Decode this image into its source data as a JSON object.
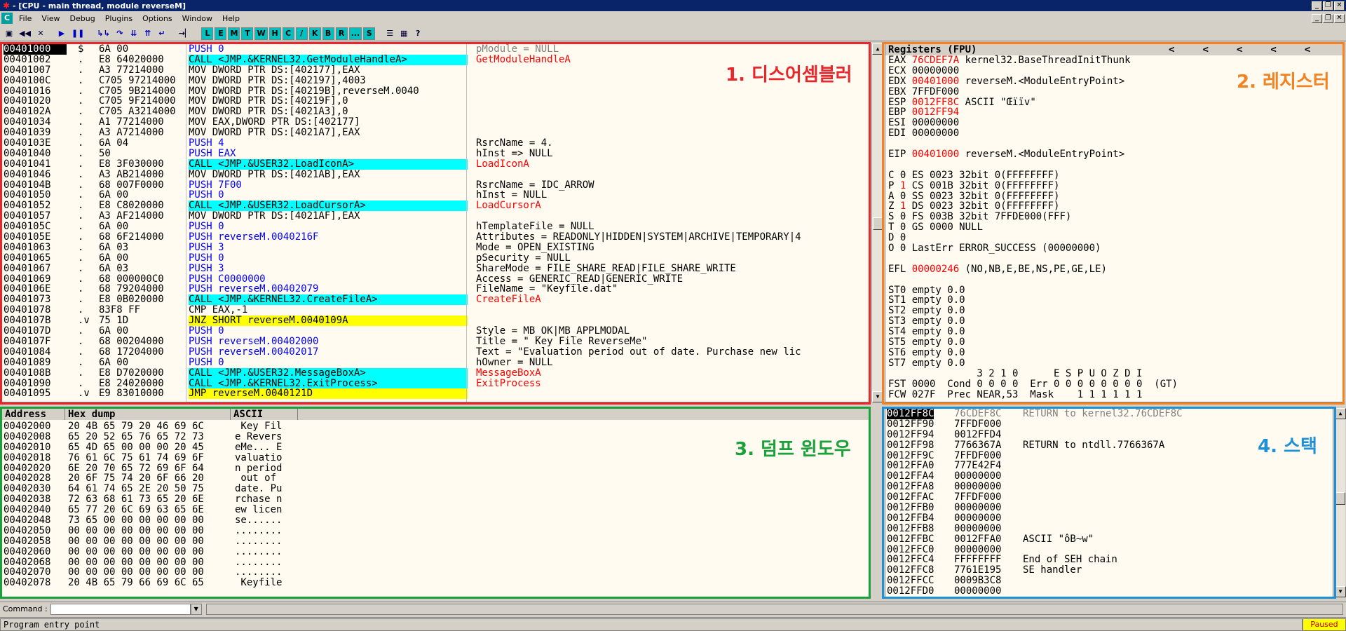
{
  "window": {
    "title": "- [CPU - main thread, module reverseM]"
  },
  "menu": [
    "File",
    "View",
    "Debug",
    "Plugins",
    "Options",
    "Window",
    "Help"
  ],
  "toolbar_letters": [
    "L",
    "E",
    "M",
    "T",
    "W",
    "H",
    "C",
    "/",
    "K",
    "B",
    "R",
    "...",
    "S"
  ],
  "disasm": [
    [
      "00401000",
      "$",
      "6A 00",
      "PUSH 0",
      "pModule = NULL"
    ],
    [
      "00401002",
      ".",
      "E8 64020000",
      "CALL <JMP.&KERNEL32.GetModuleHandleA>",
      "GetModuleHandleA"
    ],
    [
      "00401007",
      ".",
      "A3 77214000",
      "MOV DWORD PTR DS:[402177],EAX",
      ""
    ],
    [
      "0040100C",
      ".",
      "C705 97214000",
      "MOV DWORD PTR DS:[402197],4003",
      ""
    ],
    [
      "00401016",
      ".",
      "C705 9B214000",
      "MOV DWORD PTR DS:[40219B],reverseM.0040",
      ""
    ],
    [
      "00401020",
      ".",
      "C705 9F214000",
      "MOV DWORD PTR DS:[40219F],0",
      ""
    ],
    [
      "0040102A",
      ".",
      "C705 A3214000",
      "MOV DWORD PTR DS:[4021A3],0",
      ""
    ],
    [
      "00401034",
      ".",
      "A1 77214000",
      "MOV EAX,DWORD PTR DS:[402177]",
      ""
    ],
    [
      "00401039",
      ".",
      "A3 A7214000",
      "MOV DWORD PTR DS:[4021A7],EAX",
      ""
    ],
    [
      "0040103E",
      ".",
      "6A 04",
      "PUSH 4",
      "RsrcName = 4."
    ],
    [
      "00401040",
      ".",
      "50",
      "PUSH EAX",
      "hInst => NULL"
    ],
    [
      "00401041",
      ".",
      "E8 3F030000",
      "CALL <JMP.&USER32.LoadIconA>",
      "LoadIconA"
    ],
    [
      "00401046",
      ".",
      "A3 AB214000",
      "MOV DWORD PTR DS:[4021AB],EAX",
      ""
    ],
    [
      "0040104B",
      ".",
      "68 007F0000",
      "PUSH 7F00",
      "RsrcName = IDC_ARROW"
    ],
    [
      "00401050",
      ".",
      "6A 00",
      "PUSH 0",
      "hInst = NULL"
    ],
    [
      "00401052",
      ".",
      "E8 C8020000",
      "CALL <JMP.&USER32.LoadCursorA>",
      "LoadCursorA"
    ],
    [
      "00401057",
      ".",
      "A3 AF214000",
      "MOV DWORD PTR DS:[4021AF],EAX",
      ""
    ],
    [
      "0040105C",
      ".",
      "6A 00",
      "PUSH 0",
      "hTemplateFile = NULL"
    ],
    [
      "0040105E",
      ".",
      "68 6F214000",
      "PUSH reverseM.0040216F",
      "Attributes = READONLY|HIDDEN|SYSTEM|ARCHIVE|TEMPORARY|4"
    ],
    [
      "00401063",
      ".",
      "6A 03",
      "PUSH 3",
      "Mode = OPEN_EXISTING"
    ],
    [
      "00401065",
      ".",
      "6A 00",
      "PUSH 0",
      "pSecurity = NULL"
    ],
    [
      "00401067",
      ".",
      "6A 03",
      "PUSH 3",
      "ShareMode = FILE_SHARE_READ|FILE_SHARE_WRITE"
    ],
    [
      "00401069",
      ".",
      "68 000000C0",
      "PUSH C0000000",
      "Access = GENERIC_READ|GENERIC_WRITE"
    ],
    [
      "0040106E",
      ".",
      "68 79204000",
      "PUSH reverseM.00402079",
      "FileName = \"Keyfile.dat\""
    ],
    [
      "00401073",
      ".",
      "E8 0B020000",
      "CALL <JMP.&KERNEL32.CreateFileA>",
      "CreateFileA"
    ],
    [
      "00401078",
      ".",
      "83F8 FF",
      "CMP EAX,-1",
      ""
    ],
    [
      "0040107B",
      ".v",
      "75 1D",
      "JNZ SHORT reverseM.0040109A",
      ""
    ],
    [
      "0040107D",
      ".",
      "6A 00",
      "PUSH 0",
      "Style = MB_OK|MB_APPLMODAL"
    ],
    [
      "0040107F",
      ".",
      "68 00204000",
      "PUSH reverseM.00402000",
      "Title = \" Key File ReverseMe\""
    ],
    [
      "00401084",
      ".",
      "68 17204000",
      "PUSH reverseM.00402017",
      "Text = \"Evaluation period out of date. Purchase new lic"
    ],
    [
      "00401089",
      ".",
      "6A 00",
      "PUSH 0",
      "hOwner = NULL"
    ],
    [
      "0040108B",
      ".",
      "E8 D7020000",
      "CALL <JMP.&USER32.MessageBoxA>",
      "MessageBoxA"
    ],
    [
      "00401090",
      ".",
      "E8 24020000",
      "CALL <JMP.&KERNEL32.ExitProcess>",
      "ExitProcess"
    ],
    [
      "00401095",
      ".v",
      "E9 83010000",
      "JMP reverseM.0040121D",
      ""
    ]
  ],
  "registers": {
    "header": "Registers (FPU)",
    "header_arrows": [
      "<",
      "<",
      "<",
      "<",
      "<"
    ],
    "gp": [
      [
        "EAX",
        "76CDEF7A",
        "kernel32.BaseThreadInitThunk"
      ],
      [
        "ECX",
        "00000000",
        ""
      ],
      [
        "EDX",
        "00401000",
        "reverseM.<ModuleEntryPoint>"
      ],
      [
        "EBX",
        "7FFDF000",
        ""
      ],
      [
        "ESP",
        "0012FF8C",
        "ASCII \"Œïïv\""
      ],
      [
        "EBP",
        "0012FF94",
        ""
      ],
      [
        "ESI",
        "00000000",
        ""
      ],
      [
        "EDI",
        "00000000",
        ""
      ]
    ],
    "eip": [
      "EIP",
      "00401000",
      "reverseM.<ModuleEntryPoint>"
    ],
    "flags": [
      [
        "C",
        "0",
        "ES 0023 32bit 0(FFFFFFFF)"
      ],
      [
        "P",
        "1",
        "CS 001B 32bit 0(FFFFFFFF)"
      ],
      [
        "A",
        "0",
        "SS 0023 32bit 0(FFFFFFFF)"
      ],
      [
        "Z",
        "1",
        "DS 0023 32bit 0(FFFFFFFF)"
      ],
      [
        "S",
        "0",
        "FS 003B 32bit 7FFDE000(FFF)"
      ],
      [
        "T",
        "0",
        "GS 0000 NULL"
      ],
      [
        "D",
        "0",
        ""
      ],
      [
        "O",
        "0",
        "LastErr ERROR_SUCCESS (00000000)"
      ]
    ],
    "efl": [
      "EFL",
      "00000246",
      "(NO,NB,E,BE,NS,PE,GE,LE)"
    ],
    "fpu": [
      "ST0 empty 0.0",
      "ST1 empty 0.0",
      "ST2 empty 0.0",
      "ST3 empty 0.0",
      "ST4 empty 0.0",
      "ST5 empty 0.0",
      "ST6 empty 0.0",
      "ST7 empty 0.0"
    ],
    "fpu_hdr": "               3 2 1 0      E S P U O Z D I",
    "fst": "FST 0000  Cond 0 0 0 0  Err 0 0 0 0 0 0 0 0  (GT)",
    "fcw": "FCW 027F  Prec NEAR,53  Mask    1 1 1 1 1 1"
  },
  "dump": {
    "headers": [
      "Address",
      "Hex dump",
      "ASCII"
    ],
    "rows": [
      [
        "00402000",
        "20 4B 65 79 20 46 69 6C",
        " Key Fil"
      ],
      [
        "00402008",
        "65 20 52 65 76 65 72 73",
        "e Revers"
      ],
      [
        "00402010",
        "65 4D 65 00 00 00 20 45",
        "eMe... E"
      ],
      [
        "00402018",
        "76 61 6C 75 61 74 69 6F",
        "valuatio"
      ],
      [
        "00402020",
        "6E 20 70 65 72 69 6F 64",
        "n period"
      ],
      [
        "00402028",
        "20 6F 75 74 20 6F 66 20",
        " out of "
      ],
      [
        "00402030",
        "64 61 74 65 2E 20 50 75",
        "date. Pu"
      ],
      [
        "00402038",
        "72 63 68 61 73 65 20 6E",
        "rchase n"
      ],
      [
        "00402040",
        "65 77 20 6C 69 63 65 6E",
        "ew licen"
      ],
      [
        "00402048",
        "73 65 00 00 00 00 00 00",
        "se......"
      ],
      [
        "00402050",
        "00 00 00 00 00 00 00 00",
        "........"
      ],
      [
        "00402058",
        "00 00 00 00 00 00 00 00",
        "........"
      ],
      [
        "00402060",
        "00 00 00 00 00 00 00 00",
        "........"
      ],
      [
        "00402068",
        "00 00 00 00 00 00 00 00",
        "........"
      ],
      [
        "00402070",
        "00 00 00 00 00 00 00 00",
        "........"
      ],
      [
        "00402078",
        "20 4B 65 79 66 69 6C 65",
        " Keyfile"
      ]
    ]
  },
  "stack": [
    [
      "0012FF8C",
      "76CDEF8C",
      "RETURN to kernel32.76CDEF8C"
    ],
    [
      "0012FF90",
      "7FFDF000",
      ""
    ],
    [
      "0012FF94",
      "0012FFD4",
      ""
    ],
    [
      "0012FF98",
      "7766367A",
      "RETURN to ntdll.7766367A"
    ],
    [
      "0012FF9C",
      "7FFDF000",
      ""
    ],
    [
      "0012FFA0",
      "777E42F4",
      ""
    ],
    [
      "0012FFA4",
      "00000000",
      ""
    ],
    [
      "0012FFA8",
      "00000000",
      ""
    ],
    [
      "0012FFAC",
      "7FFDF000",
      ""
    ],
    [
      "0012FFB0",
      "00000000",
      ""
    ],
    [
      "0012FFB4",
      "00000000",
      ""
    ],
    [
      "0012FFB8",
      "00000000",
      ""
    ],
    [
      "0012FFBC",
      "0012FFA0",
      "ASCII \"ôB~w\""
    ],
    [
      "0012FFC0",
      "00000000",
      ""
    ],
    [
      "0012FFC4",
      "FFFFFFFF",
      "End of SEH chain"
    ],
    [
      "0012FFC8",
      "7761E195",
      "SE handler"
    ],
    [
      "0012FFCC",
      "0009B3C8",
      ""
    ],
    [
      "0012FFD0",
      "00000000",
      ""
    ]
  ],
  "annotations": {
    "disasm": "1. 디스어셈블러",
    "registers": "2. 레지스터",
    "dump": "3. 덤프 윈도우",
    "stack": "4. 스택"
  },
  "colors": {
    "disasm": "#e8262c",
    "registers": "#f58220",
    "dump": "#1aa13a",
    "stack": "#1e90d6"
  },
  "command": {
    "label": "Command :"
  },
  "status": {
    "text": "Program entry point",
    "state": "Paused"
  }
}
